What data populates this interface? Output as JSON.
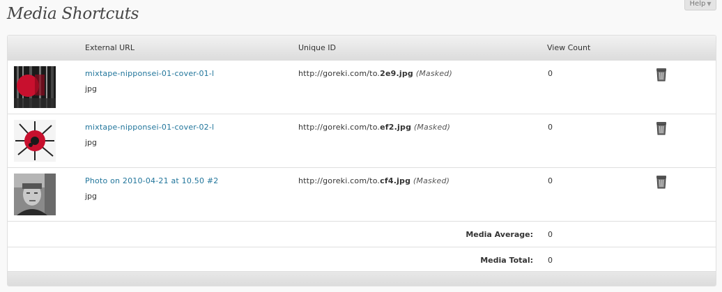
{
  "help": {
    "label": "Help",
    "arrow": "▼"
  },
  "page": {
    "title": "Media Shortcuts"
  },
  "table": {
    "headers": {
      "external_url": "External URL",
      "unique_id": "Unique ID",
      "view_count": "View Count"
    },
    "rows": [
      {
        "title": "mixtape-nipponsei-01-cover-01-l",
        "ext": "jpg",
        "url_prefix": "http://goreki.com/to.",
        "url_file": "2e9.jpg",
        "masked": "(Masked)",
        "count": "0",
        "thumb": "red-dot-cover"
      },
      {
        "title": "mixtape-nipponsei-01-cover-02-l",
        "ext": "jpg",
        "url_prefix": "http://goreki.com/to.",
        "url_file": "ef2.jpg",
        "masked": "(Masked)",
        "count": "0",
        "thumb": "red-splat-cover"
      },
      {
        "title": "Photo on 2010-04-21 at 10.50 #2",
        "ext": "jpg",
        "url_prefix": "http://goreki.com/to.",
        "url_file": "cf4.jpg",
        "masked": "(Masked)",
        "count": "0",
        "thumb": "portrait-photo"
      }
    ],
    "summary": [
      {
        "label": "Media Average:",
        "value": "0"
      },
      {
        "label": "Media Total:",
        "value": "0"
      }
    ]
  },
  "icons": {
    "delete": "trash-icon"
  },
  "colors": {
    "link": "#21759b",
    "header_bg": "#dcdcdc",
    "border": "#dfdfdf"
  }
}
